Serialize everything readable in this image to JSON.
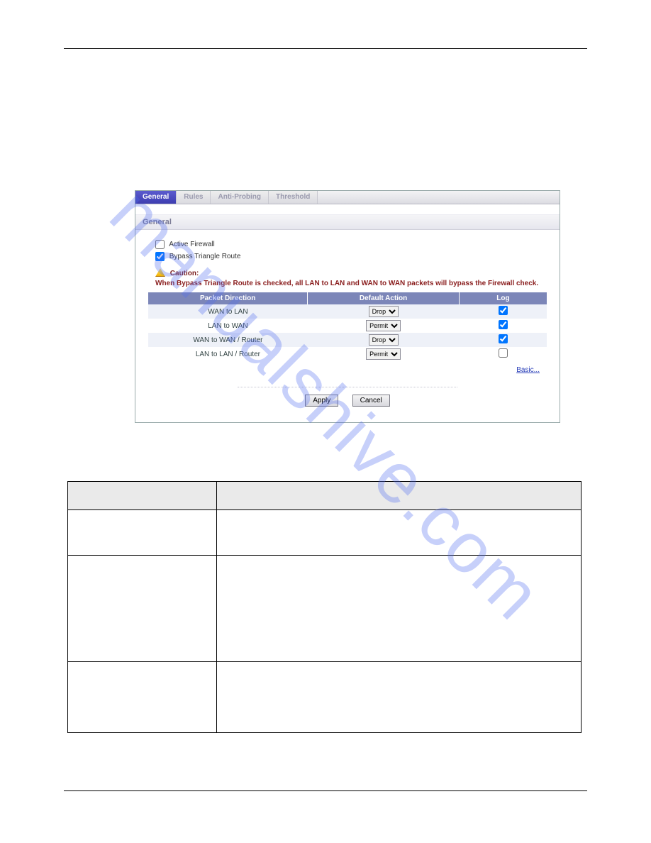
{
  "tabs": {
    "general": "General",
    "rules": "Rules",
    "anti_probing": "Anti-Probing",
    "threshold": "Threshold"
  },
  "section_title": "General",
  "checkboxes": {
    "active_firewall": {
      "label": "Active Firewall",
      "checked": false
    },
    "bypass_triangle": {
      "label": "Bypass Triangle Route",
      "checked": true
    }
  },
  "caution": {
    "heading": "Caution:",
    "text": "When Bypass Triangle Route is checked, all LAN to LAN and WAN to WAN packets will bypass the Firewall check."
  },
  "columns": {
    "direction": "Packet Direction",
    "action": "Default Action",
    "log": "Log"
  },
  "action_options": [
    "Drop",
    "Permit"
  ],
  "rows": [
    {
      "direction": "WAN to LAN",
      "action": "Drop",
      "log": true
    },
    {
      "direction": "LAN to WAN",
      "action": "Permit",
      "log": true
    },
    {
      "direction": "WAN to WAN / Router",
      "action": "Drop",
      "log": true
    },
    {
      "direction": "LAN to LAN / Router",
      "action": "Permit",
      "log": false
    }
  ],
  "basic_link": "Basic...",
  "buttons": {
    "apply": "Apply",
    "cancel": "Cancel"
  },
  "watermark": "manualshive.com"
}
